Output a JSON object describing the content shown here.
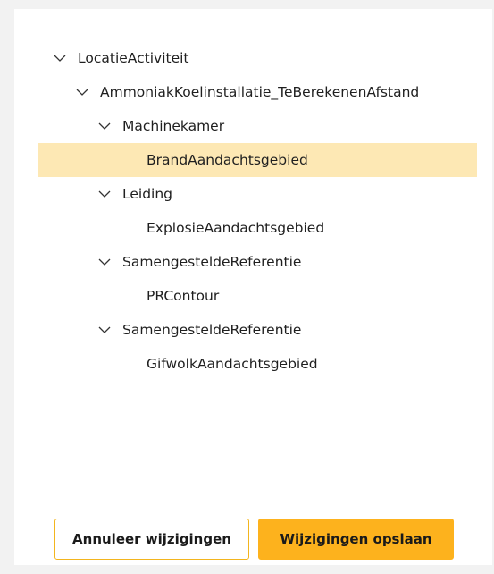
{
  "tree": {
    "root": {
      "label": "LocatieActiviteit",
      "icon": "chevron-down-icon"
    },
    "child": {
      "label": "AmmoniakKoelinstallatie_TeBerekenenAfstand",
      "icon": "chevron-down-icon"
    },
    "groups": [
      {
        "label": "Machinekamer",
        "icon": "chevron-down-icon",
        "leaf": "BrandAandachtsgebied",
        "selected": true
      },
      {
        "label": "Leiding",
        "icon": "chevron-down-icon",
        "leaf": "ExplosieAandachtsgebied",
        "selected": false
      },
      {
        "label": "SamengesteldeReferentie",
        "icon": "chevron-down-icon",
        "leaf": "PRContour",
        "selected": false
      },
      {
        "label": "SamengesteldeReferentie",
        "icon": "chevron-down-icon",
        "leaf": "GifwolkAandachtsgebied",
        "selected": false
      }
    ]
  },
  "footer": {
    "cancel_label": "Annuleer wijzigingen",
    "save_label": "Wijzigingen opslaan"
  },
  "colors": {
    "accent": "#fdb21d",
    "selected_row": "#fde8b4",
    "background": "#f2f2f2"
  }
}
